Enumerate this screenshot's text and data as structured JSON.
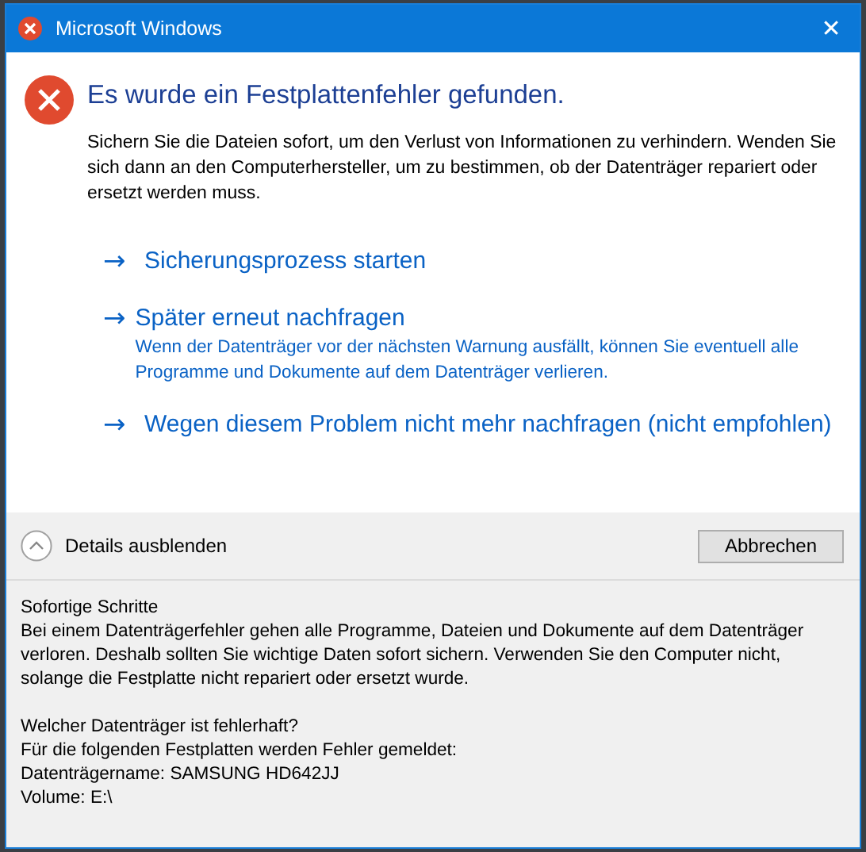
{
  "window": {
    "title": "Microsoft Windows",
    "close_glyph": "✕"
  },
  "heading": "Es wurde ein Festplattenfehler gefunden.",
  "message": "Sichern Sie die Dateien sofort, um den Verlust von Informationen zu verhindern. Wenden Sie sich dann an den Computerhersteller, um zu bestimmen, ob der Datenträger repariert oder ersetzt werden muss.",
  "options": [
    {
      "arrow": "→",
      "label": "Sicherungsprozess starten"
    },
    {
      "arrow": "→",
      "label": "Später erneut nachfragen",
      "description": "Wenn der Datenträger vor der nächsten Warnung ausfällt, können Sie eventuell alle Programme und Dokumente auf dem Datenträger verlieren."
    },
    {
      "arrow": "→",
      "label": "Wegen diesem Problem nicht mehr nachfragen (nicht empfohlen)"
    }
  ],
  "details_toggle": {
    "label": "Details ausblenden",
    "expanded": true
  },
  "cancel_button": "Abbrechen",
  "details": [
    {
      "title": "Sofortige Schritte",
      "lines": [
        "Bei einem Datenträgerfehler gehen alle Programme, Dateien und Dokumente auf dem Datenträger verloren. Deshalb sollten Sie wichtige Daten sofort sichern. Verwenden Sie den Computer nicht, solange die Festplatte nicht repariert oder ersetzt wurde."
      ]
    },
    {
      "title": "Welcher Datenträger ist fehlerhaft?",
      "lines": [
        "Für die folgenden Festplatten werden Fehler gemeldet:",
        "Datenträgername: SAMSUNG HD642JJ",
        "Volume: E:\\"
      ]
    }
  ]
}
